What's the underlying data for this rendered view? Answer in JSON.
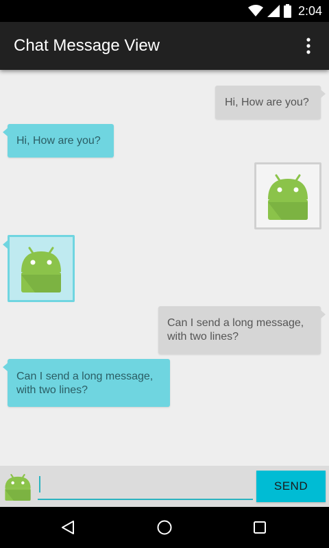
{
  "status_bar": {
    "time": "2:04",
    "icons": [
      "wifi-icon",
      "signal-icon",
      "battery-icon"
    ]
  },
  "app_bar": {
    "title": "Chat Message View",
    "menu_icon": "overflow-menu-icon"
  },
  "messages": [
    {
      "side": "out",
      "type": "text",
      "text": "Hi, How are you?"
    },
    {
      "side": "in",
      "type": "text",
      "text": "Hi, How are you?"
    },
    {
      "side": "out",
      "type": "image",
      "icon": "android-icon"
    },
    {
      "side": "in",
      "type": "image",
      "icon": "android-icon"
    },
    {
      "side": "out",
      "type": "text",
      "text": "Can I send a long message,\nwith two lines?"
    },
    {
      "side": "in",
      "type": "text",
      "text": "Can I send a long message,\nwith two lines?"
    }
  ],
  "input_bar": {
    "avatar_icon": "android-icon",
    "input_value": "",
    "input_placeholder": "",
    "send_label": "SEND"
  },
  "nav_bar": {
    "icons": [
      "back-icon",
      "home-icon",
      "recents-icon"
    ]
  },
  "colors": {
    "outgoing_bubble": "#d6d6d6",
    "incoming_bubble": "#6fd5e0",
    "send_button": "#00bcd4",
    "app_bar": "#212121",
    "android_green": "#8bc34a"
  }
}
